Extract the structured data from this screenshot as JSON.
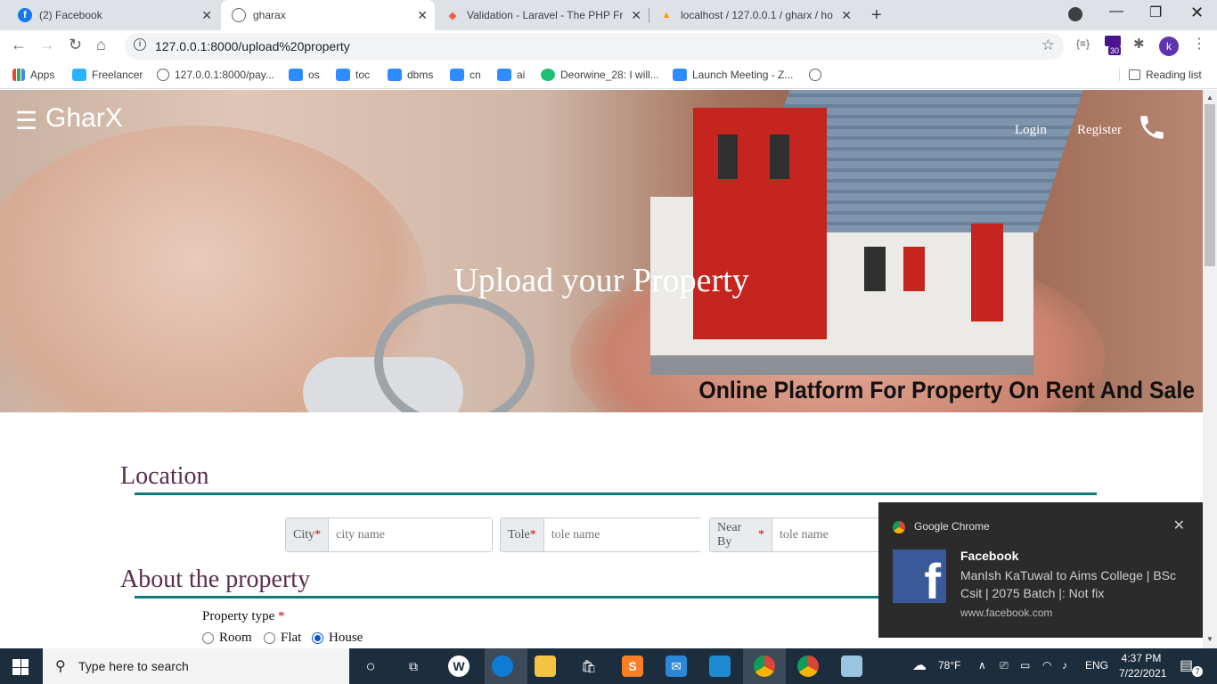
{
  "browser": {
    "tabs": [
      {
        "label": "(2) Facebook",
        "icon": "facebook-icon"
      },
      {
        "label": "gharax",
        "icon": "globe-icon"
      },
      {
        "label": "Validation - Laravel - The PHP Fra",
        "icon": "laravel-icon"
      },
      {
        "label": "localhost / 127.0.0.1 / gharx / ho",
        "icon": "phpmyadmin-icon"
      }
    ],
    "url": "127.0.0.1:8000/upload%20property",
    "profile_initial": "k",
    "extension_badge": "30",
    "ext_json_label": "{≡}"
  },
  "bookmarks": [
    {
      "label": "Apps"
    },
    {
      "label": "Freelancer"
    },
    {
      "label": "127.0.0.1:8000/pay..."
    },
    {
      "label": "os"
    },
    {
      "label": "toc"
    },
    {
      "label": "dbms"
    },
    {
      "label": "cn"
    },
    {
      "label": "ai"
    },
    {
      "label": "Deorwine_28: I will..."
    },
    {
      "label": "Launch Meeting - Z..."
    }
  ],
  "reading_list": "Reading list",
  "site": {
    "logo": "GharX",
    "nav": {
      "login": "Login",
      "register": "Register"
    },
    "hero_title": "Upload your Property",
    "tagline": "Online Platform For Property On Rent And Sale"
  },
  "location": {
    "title": "Location",
    "fields": [
      {
        "label": "City",
        "required": "*",
        "placeholder": "city name"
      },
      {
        "label": "Tole",
        "required": "*",
        "placeholder": "tole name"
      },
      {
        "label": "Near By",
        "required": "*",
        "placeholder": "tole name"
      }
    ]
  },
  "about": {
    "title": "About the property",
    "property_type_label": "Property type",
    "required": "*",
    "options": [
      {
        "label": "Room",
        "selected": false
      },
      {
        "label": "Flat",
        "selected": false
      },
      {
        "label": "House",
        "selected": true
      }
    ]
  },
  "notification": {
    "source": "Google Chrome",
    "title": "Facebook",
    "body": "ManIsh KaTuwal to Aims College | BSc Csit | 2075 Batch |: Not fix",
    "url": "www.facebook.com"
  },
  "taskbar": {
    "search_placeholder": "Type here to search",
    "weather": "78°F",
    "language": "ENG",
    "time": "4:37 PM",
    "date": "7/22/2021",
    "notification_count": "7"
  },
  "colors": {
    "accent_line": "#0e7a7a",
    "section_title": "#5a2d4e",
    "taskbar": "#1c2d3e"
  }
}
